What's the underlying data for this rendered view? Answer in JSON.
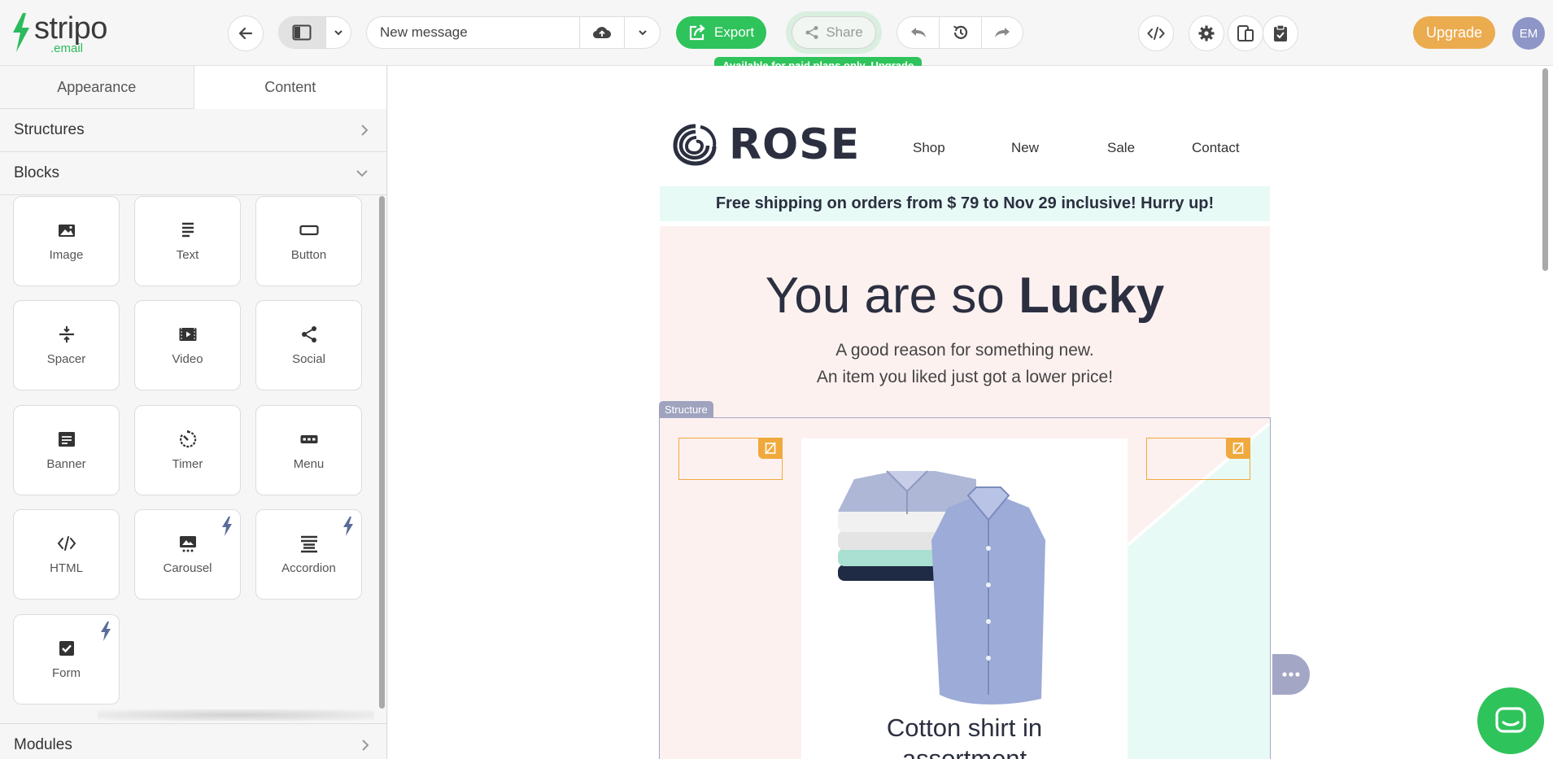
{
  "app": {
    "logo_main": "stripo",
    "logo_sub": ".email"
  },
  "toolbar": {
    "message_name": "New message",
    "export_label": "Export",
    "share_label": "Share",
    "paid_notice": "Available for paid plans only.",
    "paid_link": "Upgrade",
    "upgrade_label": "Upgrade",
    "avatar_initials": "EM"
  },
  "sidebar": {
    "tabs": [
      "Appearance",
      "Content"
    ],
    "active_tab": "Content",
    "structures_label": "Structures",
    "blocks_label": "Blocks",
    "modules_label": "Modules",
    "blocks": [
      {
        "label": "Image",
        "icon": "image-icon",
        "pro": false
      },
      {
        "label": "Text",
        "icon": "text-icon",
        "pro": false
      },
      {
        "label": "Button",
        "icon": "button-icon",
        "pro": false
      },
      {
        "label": "Spacer",
        "icon": "spacer-icon",
        "pro": false
      },
      {
        "label": "Video",
        "icon": "video-icon",
        "pro": false
      },
      {
        "label": "Social",
        "icon": "social-icon",
        "pro": false
      },
      {
        "label": "Banner",
        "icon": "banner-icon",
        "pro": false
      },
      {
        "label": "Timer",
        "icon": "timer-icon",
        "pro": false
      },
      {
        "label": "Menu",
        "icon": "menu-icon",
        "pro": false
      },
      {
        "label": "HTML",
        "icon": "html-icon",
        "pro": false
      },
      {
        "label": "Carousel",
        "icon": "carousel-icon",
        "pro": true
      },
      {
        "label": "Accordion",
        "icon": "accordion-icon",
        "pro": true
      },
      {
        "label": "Form",
        "icon": "form-icon",
        "pro": true
      }
    ]
  },
  "email": {
    "brand": "ROSE",
    "nav": [
      "Shop",
      "New",
      "Sale",
      "Contact"
    ],
    "shipping_banner": "Free shipping on orders from $ 79 to Nov 29 inclusive! Hurry up!",
    "hero_title_light": "You are so ",
    "hero_title_bold": "Lucky",
    "hero_line1": "A good reason for something new.",
    "hero_line2": "An item you liked just got a lower price!",
    "structure_tag": "Structure",
    "product_title_line1": "Cotton shirt in",
    "product_title_line2": "assortment"
  },
  "colors": {
    "accent_green": "#2fc35b",
    "upgrade_orange": "#ebab4f",
    "hero_pink": "#fdf1f0",
    "mint": "#e7faf5",
    "navy": "#2b2f40"
  }
}
